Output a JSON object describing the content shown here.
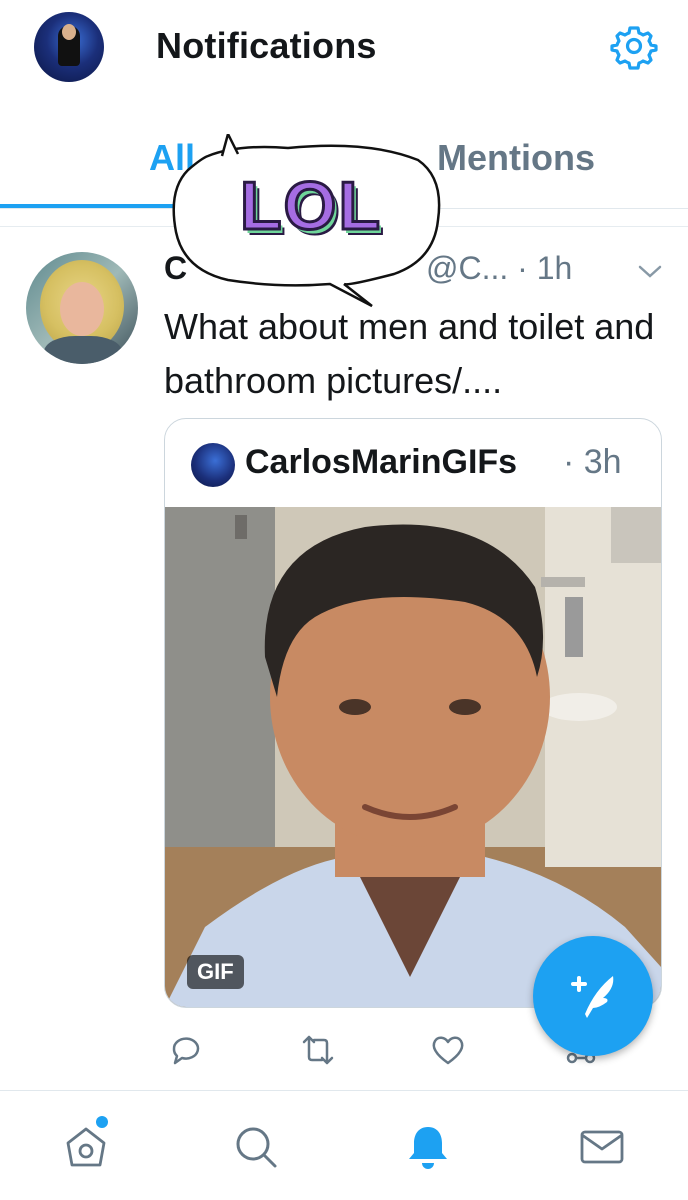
{
  "header": {
    "title": "Notifications",
    "icons": {
      "avatar": "profile-avatar",
      "settings": "gear-icon"
    },
    "accent_color": "#1da1f2"
  },
  "tabs": [
    {
      "label": "All",
      "active": true
    },
    {
      "label": "Mentions",
      "active": false
    }
  ],
  "tweet": {
    "author_initial": "C",
    "handle_time": "@C... · 1h",
    "text": "What about men and toilet and bathroom pictures/....",
    "quoted": {
      "name": "CarlosMarinGIFs",
      "time": "· 3h",
      "media_badge": "GIF"
    },
    "actions": [
      "reply-icon",
      "retweet-icon",
      "like-icon",
      "share-icon"
    ]
  },
  "sticker": {
    "text": "LOL"
  },
  "fab": {
    "icon": "compose-tweet-icon"
  },
  "bottom_nav": {
    "items": [
      "home-icon",
      "search-icon",
      "notifications-icon",
      "messages-icon"
    ],
    "active": "notifications-icon"
  }
}
